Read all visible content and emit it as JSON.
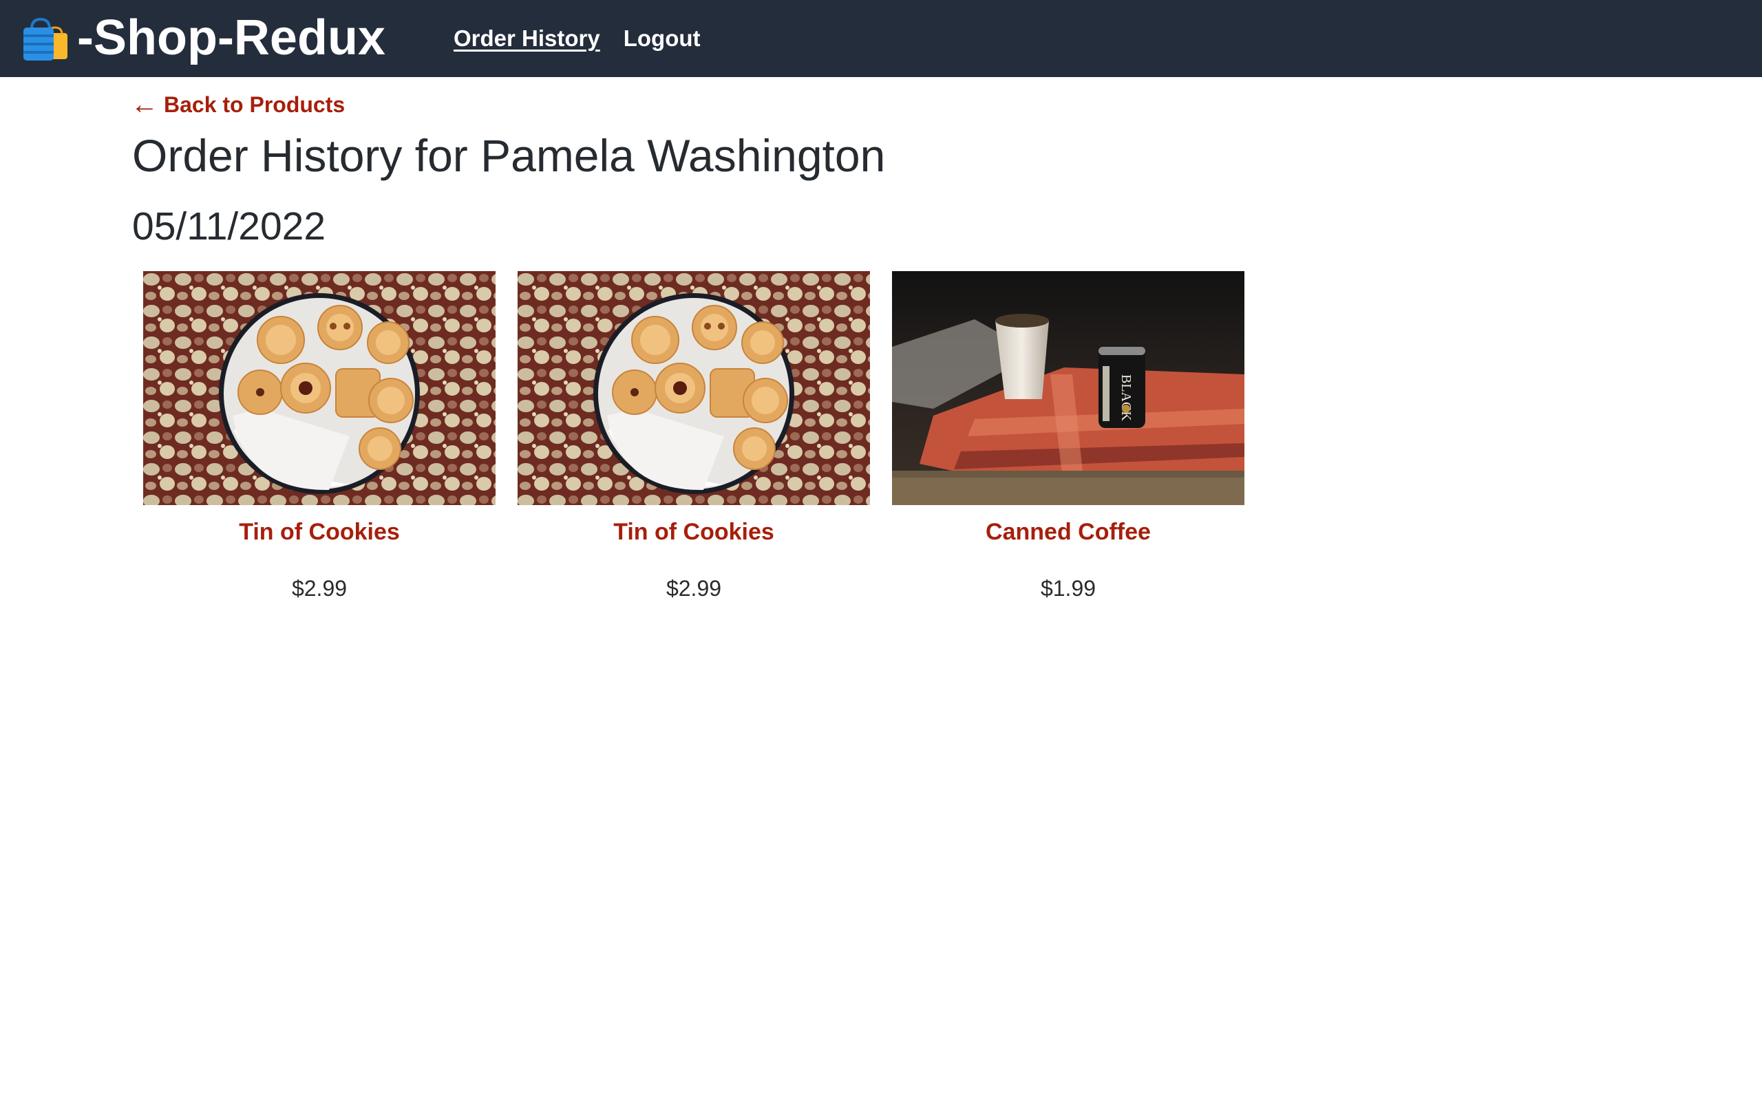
{
  "header": {
    "brand_text": "-Shop-Redux",
    "logo_icon": "shopping-bags-icon",
    "background_color": "#242d3c",
    "nav": {
      "order_history": "Order History",
      "logout": "Logout"
    }
  },
  "main": {
    "back_link": {
      "arrow": "←",
      "label": "Back to Products"
    },
    "title": "Order History for Pamela Washington",
    "orders": [
      {
        "date": "05/11/2022",
        "products": [
          {
            "name": "Tin of Cookies",
            "price": "$2.99",
            "image": "cookie-tin-photo"
          },
          {
            "name": "Tin of Cookies",
            "price": "$2.99",
            "image": "cookie-tin-photo"
          },
          {
            "name": "Canned Coffee",
            "price": "$1.99",
            "image": "canned-coffee-photo"
          }
        ]
      }
    ]
  },
  "colors": {
    "accent": "#a61f0b",
    "text": "#262b31"
  }
}
